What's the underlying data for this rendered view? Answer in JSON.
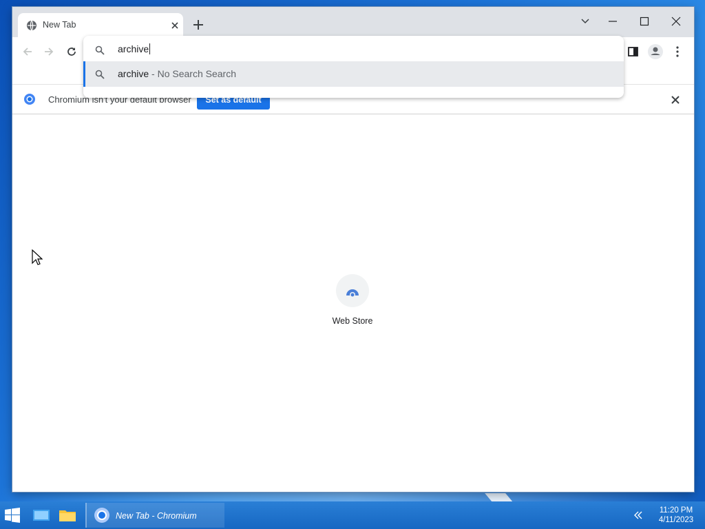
{
  "window": {
    "tab_title": "New Tab",
    "omnibox_query": "archive",
    "suggestion_query": "archive",
    "suggestion_suffix": " - No Search Search"
  },
  "infobar": {
    "message": "Chromium isn't your default browser",
    "button_label": "Set as default"
  },
  "content": {
    "shortcut_label": "Web Store"
  },
  "taskbar": {
    "app_label": "New Tab - Chromium",
    "time": "11:20 PM",
    "date": "4/11/2023"
  },
  "colors": {
    "accent": "#1a73e8",
    "titlebar": "#dee1e6",
    "taskbar": "#1a6fcb"
  },
  "icons": [
    "globe-icon",
    "close-icon",
    "new-tab-icon",
    "minimize-icon",
    "maximize-icon",
    "window-close-icon",
    "back-icon",
    "forward-icon",
    "reload-icon",
    "search-icon",
    "side-panel-icon",
    "profile-icon",
    "menu-icon",
    "chromium-logo-icon",
    "windows-start-icon",
    "task-view-icon",
    "file-explorer-icon",
    "chrome-icon",
    "chevron-left-icon"
  ]
}
